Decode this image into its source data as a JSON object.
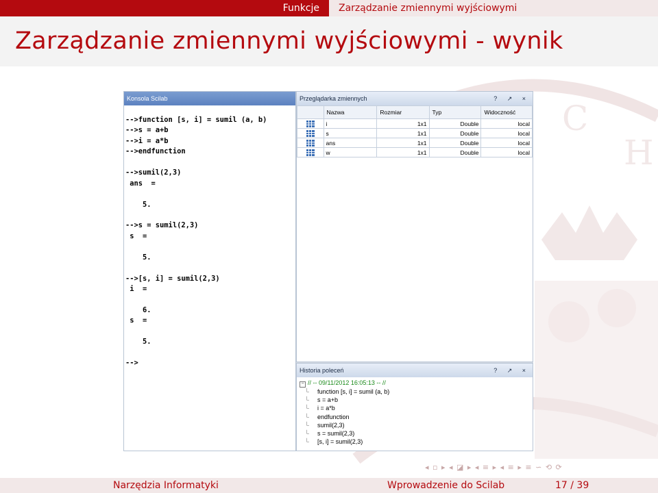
{
  "header": {
    "section": "Funkcje",
    "subsection": "Zarządzanie zmiennymi wyjściowymi"
  },
  "frame_title": "Zarządzanie zmiennymi wyjściowymi - wynik",
  "console": {
    "title": "Konsola Scilab",
    "lines": [
      "-->function [s, i] = sumil (a, b)",
      "-->s = a+b",
      "-->i = a*b",
      "-->endfunction",
      "",
      "-->sumil(2,3)",
      " ans  =",
      "",
      "    5.",
      "",
      "-->s = sumil(2,3)",
      " s  =",
      "",
      "    5.",
      "",
      "-->[s, i] = sumil(2,3)",
      " i  =",
      "",
      "    6.",
      " s  =",
      "",
      "    5.",
      "",
      "-->"
    ]
  },
  "variable_browser": {
    "title": "Przeglądarka zmiennych",
    "buttons": "? ↗ ×",
    "columns": [
      "Nazwa",
      "Rozmiar",
      "Typ",
      "Widoczność"
    ],
    "rows": [
      {
        "name": "i",
        "size": "1x1",
        "type": "Double",
        "visibility": "local"
      },
      {
        "name": "s",
        "size": "1x1",
        "type": "Double",
        "visibility": "local"
      },
      {
        "name": "ans",
        "size": "1x1",
        "type": "Double",
        "visibility": "local"
      },
      {
        "name": "w",
        "size": "1x1",
        "type": "Double",
        "visibility": "local"
      }
    ]
  },
  "history": {
    "title": "Historia poleceń",
    "buttons": "? ↗ ×",
    "root": "// -- 09/11/2012 16:05:13 -- //",
    "items": [
      "function [s, i] = sumil (a, b)",
      "s = a+b",
      "i = a*b",
      "endfunction",
      "sumil(2,3)",
      "s = sumil(2,3)",
      "[s, i] = sumil(2,3)"
    ]
  },
  "nav_symbols": "◂ ▫ ▸  ◂ ◪ ▸  ◂ ≡ ▸  ◂ ≡ ▸   ≡   ∽ ⟲ ⟳",
  "footer": {
    "author": "Narzędzia Informatyki",
    "title": "Wprowadzenie do Scilab",
    "page": "17 / 39"
  }
}
